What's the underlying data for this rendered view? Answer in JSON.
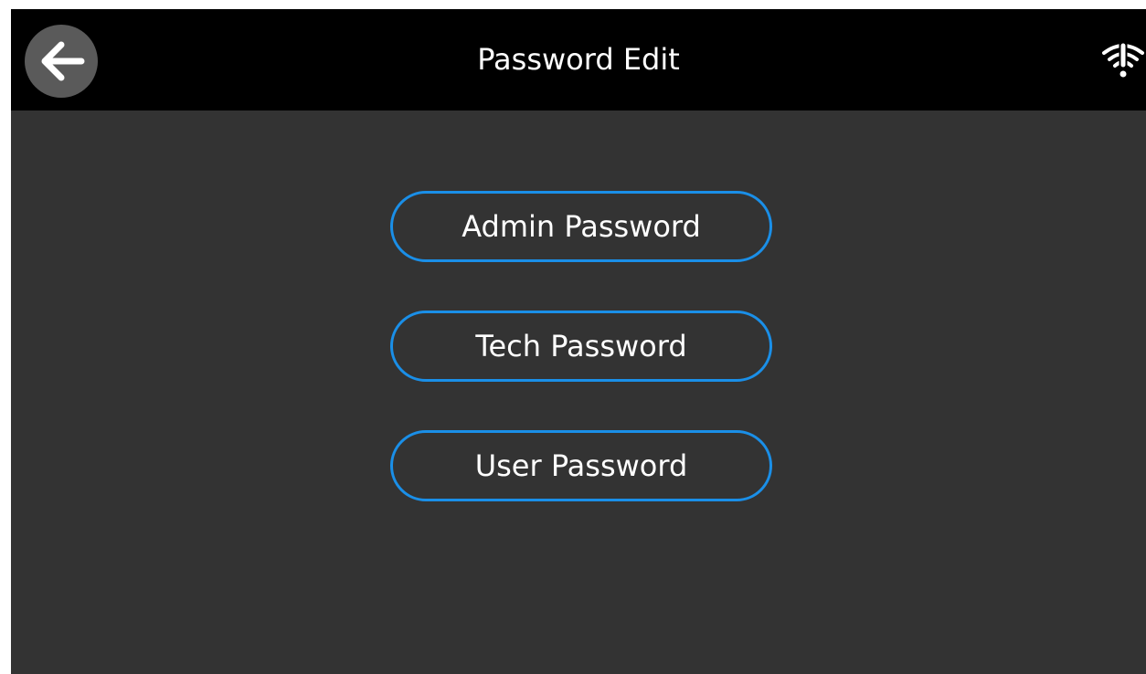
{
  "header": {
    "title": "Password Edit",
    "back_icon": "arrow-left-icon",
    "status_icon": "wifi-alert-icon"
  },
  "buttons": [
    {
      "label": "Admin Password"
    },
    {
      "label": "Tech Password"
    },
    {
      "label": "User Password"
    }
  ],
  "colors": {
    "background": "#333333",
    "header": "#000000",
    "accent": "#1a8fe8",
    "text": "#ffffff",
    "back_circle": "#5a5a5a"
  }
}
